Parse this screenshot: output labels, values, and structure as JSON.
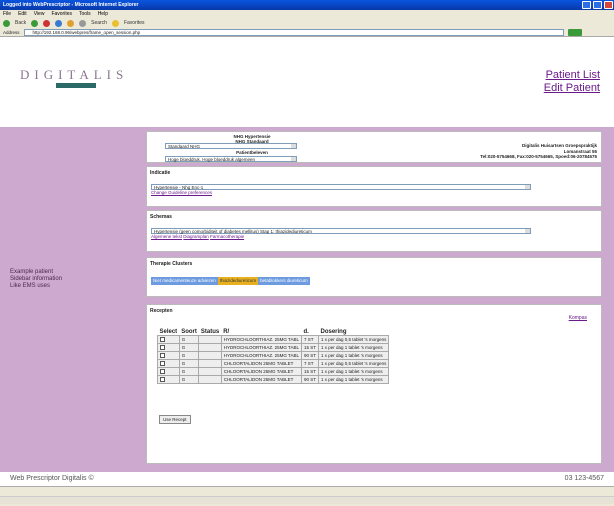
{
  "window": {
    "title": "Logged into WebPrescriptor - Microsoft Internet Explorer"
  },
  "menu": [
    "File",
    "Edit",
    "View",
    "Favorites",
    "Tools",
    "Help"
  ],
  "toolbar": {
    "back": "Back",
    "search": "Search",
    "favorites": "Favorites"
  },
  "address": {
    "label": "Address",
    "url": "http://192.168.0.96/webpres/frame_open_session.php"
  },
  "logo": {
    "text": "DIGITALIS"
  },
  "nav": {
    "patient_list": "Patient List",
    "edit_patient": "Edit Patient"
  },
  "sidebar": {
    "lines": [
      "Example patient",
      "Sidebar information",
      "Like EMS uses"
    ]
  },
  "standard": {
    "title1": "NHG Hypertensie",
    "title2": "NHG Standaard",
    "select1": "Standaard NHG",
    "sub": "Patientbeleven",
    "select2": "Hoge bloeddruk. Hoge bloeddruk algemeen",
    "practice_name": "Digitalis Huisartsen Groepspraktijk",
    "practice_street": "Lomanstraat 55",
    "practice_contact": "Tel:020-5754668, Fax:020-5754665, Spoed:06-20784575"
  },
  "indicatie": {
    "title": "Indicatie",
    "value": "Hypertensie - Nhg Enc-1",
    "link": "Change Guideline preferences"
  },
  "schemas": {
    "title": "Schemas",
    "value": "Hypertensie (geen comorbiditeit of diabetes mellitus) Stap 1: thiazidediureticum",
    "link1": "Algemene tekst",
    "link2": "Diagramplan",
    "link3": "Farmacotherapie"
  },
  "clusters": {
    "title": "Therapie Clusters",
    "items": [
      "Niet medicamenteuze adviezen",
      "thiazidediureticum",
      "betablokkers diureticum"
    ]
  },
  "recepten": {
    "title": "Recepten",
    "kompas": "Kompas",
    "headers": [
      "Select",
      "Soort",
      "Status",
      "R/",
      "d.",
      "Dosering"
    ],
    "rows": [
      {
        "soort": "G",
        "status": "",
        "r": "HYDROCHLOORTHIAZ. 25MG TABL",
        "d": "7 ST",
        "dosering": "1 x per dag 0,5 tablet 's morgens"
      },
      {
        "soort": "G",
        "status": "",
        "r": "HYDROCHLOORTHIAZ. 25MG TABL",
        "d": "15 ST",
        "dosering": "1 x per dag 1 tablet 's morgens"
      },
      {
        "soort": "G",
        "status": "",
        "r": "HYDROCHLOORTHIAZ. 25MG TABL",
        "d": "90 ST",
        "dosering": "1 x per dag 1 tablet 's morgens"
      },
      {
        "soort": "G",
        "status": "",
        "r": "CHLOORTALIDON 25MG TABLET",
        "d": "7 ST",
        "dosering": "1 x per dag 0,5 tablet 's morgens"
      },
      {
        "soort": "G",
        "status": "",
        "r": "CHLOORTALIDON 25MG TABLET",
        "d": "15 ST",
        "dosering": "1 x per dag 1 tablet 's morgens"
      },
      {
        "soort": "G",
        "status": "",
        "r": "CHLOORTALIDON 25MG TABLET",
        "d": "90 ST",
        "dosering": "1 x per dag 1 tablet 's morgens"
      }
    ],
    "use_button": "Use Recept"
  },
  "footer": {
    "left": "Web Prescriptor Digitalis ©",
    "right": "03 123-4567"
  },
  "colors": {
    "accent": "#cda8cf",
    "link": "#6a1a8a",
    "selected_cluster": "#e8b020"
  }
}
